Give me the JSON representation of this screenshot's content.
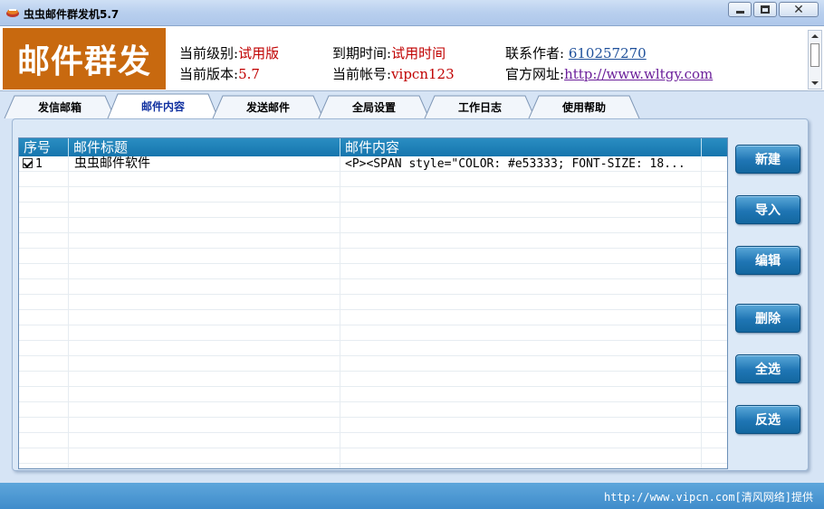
{
  "window": {
    "title": "虫虫邮件群发机5.7",
    "controls": {
      "minimize": "minimize",
      "maximize": "maximize",
      "close": "✕"
    }
  },
  "header": {
    "logo_text": "邮件群发",
    "level_label": "当前级别:",
    "level_value": "试用版",
    "version_label": "当前版本:",
    "version_value": "5.7",
    "expiry_label": "到期时间:",
    "expiry_value": "试用时间",
    "account_label": "当前帐号:",
    "account_value": "vipcn123",
    "contact_label": "联系作者: ",
    "contact_value": "610257270",
    "site_label": "官方网址:",
    "site_value": "http://www.wltgy.com"
  },
  "tabs": [
    {
      "label": "发信邮箱",
      "active": false
    },
    {
      "label": "邮件内容",
      "active": true
    },
    {
      "label": "发送邮件",
      "active": false
    },
    {
      "label": "全局设置",
      "active": false
    },
    {
      "label": "工作日志",
      "active": false
    },
    {
      "label": "使用帮助",
      "active": false
    }
  ],
  "grid": {
    "columns": [
      "序号",
      "邮件标题",
      "邮件内容"
    ],
    "rows": [
      {
        "checked": true,
        "index": "1",
        "title": "虫虫邮件软件",
        "content": "<P><SPAN style=\"COLOR: #e53333; FONT-SIZE: 18..."
      }
    ]
  },
  "buttons": {
    "new": "新建",
    "import": "导入",
    "edit": "编辑",
    "delete": "删除",
    "select_all": "全选",
    "invert": "反选"
  },
  "status": {
    "text": "http://www.vipcn.com[清风网络]提供"
  }
}
